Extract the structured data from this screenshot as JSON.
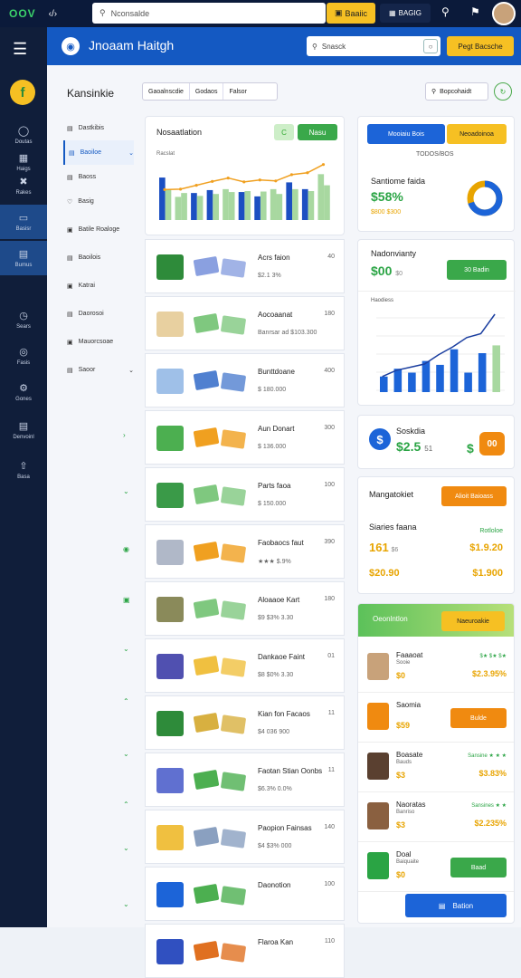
{
  "topbar": {
    "logo": "OOV",
    "search_value": "Nconsalde",
    "yellow_button": "Baaiic",
    "dark_chip": "BAGIG"
  },
  "header": {
    "title": "Jnoaam Haitgh",
    "search_placeholder": "Snasck",
    "button": "Pegt Bacsche"
  },
  "sidebar": {
    "items": [
      {
        "label": "Doutas",
        "icon": "dashboard-icon"
      },
      {
        "label": "Haigs",
        "icon": "grid-icon"
      },
      {
        "label": "Rakes",
        "icon": "tools-icon"
      },
      {
        "label": "Basisr",
        "icon": "wallet-icon"
      },
      {
        "label": "Bumus",
        "icon": "card-icon"
      },
      {
        "label": "Sears",
        "icon": "clock-icon"
      },
      {
        "label": "Fasis",
        "icon": "globe-icon"
      },
      {
        "label": "Gones",
        "icon": "gear-icon"
      },
      {
        "label": "Denvoinl",
        "icon": "chart-icon"
      },
      {
        "label": "Basa",
        "icon": "upload-icon"
      }
    ]
  },
  "page": {
    "title": "Kansinkie",
    "tabs": [
      "Gaoalnscdie",
      "Godaos",
      "Falsor"
    ],
    "right_search": "Bopcohaidt"
  },
  "subnav": {
    "items": [
      "Dastkibis",
      "Baoiloe",
      "Baoss",
      "Basig",
      "Batile Roaloge",
      "Baoilois",
      "Katrai",
      "Daorosoi",
      "Mauorcsoae",
      "Saoor"
    ]
  },
  "main_chart": {
    "title": "Nosaatlation",
    "subtitle": "Racslat",
    "btn_small": "C",
    "btn_main": "Nasu"
  },
  "chart_data": {
    "type": "bar",
    "series": [
      {
        "values": [
          8.8,
          4.8,
          5.6,
          6.2,
          6.4,
          5.8,
          4.9,
          6.4,
          7.8,
          6.4,
          9.5
        ]
      },
      {
        "values": [
          6.4,
          5.6,
          5.0,
          5.4,
          5.8,
          6.0,
          5.9,
          5.4,
          6.4,
          6.0,
          7.2
        ]
      }
    ],
    "line": [
      6.3,
      6.4,
      7.2,
      8.0,
      8.7,
      7.9,
      8.3,
      8.1,
      9.4,
      9.8,
      11.5
    ],
    "ylim": [
      0,
      12
    ],
    "colors": {
      "blue": "#1c4fc2",
      "green": "#a8d8a0",
      "orange": "#f0a020"
    }
  },
  "list": [
    {
      "title": "Acrs faion",
      "value": "$2.1 3%",
      "num": "40"
    },
    {
      "title": "Aocoaanat",
      "value": "Banrsar ad\n$103.300",
      "num": "180"
    },
    {
      "title": "Bunttdoane",
      "value": "$ 180.000",
      "num": "400"
    },
    {
      "title": "Aun Donart",
      "value": "$ 136.000",
      "num": "300"
    },
    {
      "title": "Parts faoa",
      "value": "$ 150.000",
      "num": "100"
    },
    {
      "title": "Faobaocs faut",
      "value": "★★★ $.9%",
      "num": "390"
    },
    {
      "title": "Aloaaoe Kart",
      "value": "$9 $3% 3.30",
      "num": "180"
    },
    {
      "title": "Dankaoe Faint",
      "value": "$8 $0% 3.30",
      "num": "01"
    },
    {
      "title": "Kian fon Facaos",
      "value": "$4 036 900",
      "num": "11"
    },
    {
      "title": "Faotan Stian Oonbs",
      "value": "$6.3% 0.0%",
      "num": "11"
    },
    {
      "title": "Paopion Fainsas",
      "value": "$4 $3% 000",
      "num": "140"
    },
    {
      "title": "Daonotion",
      "value": "",
      "num": "100"
    },
    {
      "title": "Flaroa Kan",
      "value": "",
      "num": "110"
    }
  ],
  "right": {
    "tabs": [
      "Mooiaiu Bois",
      "Neoadoinoa"
    ],
    "card1_label": "TODOS/BOS",
    "card1_title": "Santiome faida",
    "card1_value": "$58%",
    "card1_sub": "$800 $300",
    "card1_donut": [
      0.7,
      0.2,
      0.1
    ],
    "card2_title": "Nadonvianty",
    "card2_value": "$00",
    "card2_sub": "$0",
    "card2_btn": "30 Badin",
    "card2_chart_label": "Haodiess",
    "card2_bars": [
      2,
      3,
      2.5,
      4,
      3.5,
      5.5,
      2.5,
      5,
      6
    ],
    "card2_line": [
      2,
      2.8,
      3.2,
      3.6,
      4.8,
      5.8,
      7,
      7.5,
      10
    ],
    "card3_title": "Soskdia",
    "card3_value": "$2.5",
    "card3_value_small": "51",
    "card3_dollar": "$",
    "card3_btn": "00",
    "card4_title": "Mangatokiet",
    "card4_btn": "Alioit Baioass",
    "card4_row1_label": "Siaries faana",
    "card4_row1_right": "Rotloloe",
    "card4_row1_left": "161",
    "card4_row1_left_sub": "$6",
    "card4_row1_val": "$1.9.20",
    "card4_row2_left": "$20.90",
    "card4_row2_val": "$1.900",
    "card5_header": "Oeonlntlon",
    "card5_header_btn": "Naeuroakie",
    "card5_rows": [
      {
        "title": "Faaaoat",
        "sub": "Sooie",
        "amt": "$0",
        "right": "$★ $★ $★",
        "val": "$2.3.95%",
        "btn": ""
      },
      {
        "title": "Saomia",
        "sub": "",
        "amt": "$59",
        "right": "",
        "val": "",
        "btn": "Bulde"
      },
      {
        "title": "Boasate",
        "sub": "Bauds",
        "amt": "$3",
        "right": "Sansine ★ ★ ★",
        "val": "$3.83%",
        "btn": ""
      },
      {
        "title": "Naoratas",
        "sub": "Banriso",
        "amt": "$3",
        "right": "Sansines ★ ★",
        "val": "$2.235%",
        "btn": ""
      },
      {
        "title": "Doal",
        "sub": "Baiquaite",
        "amt": "$0",
        "right": "",
        "val": "",
        "btn": "Baad"
      }
    ],
    "bottom_btn": "Bation"
  }
}
